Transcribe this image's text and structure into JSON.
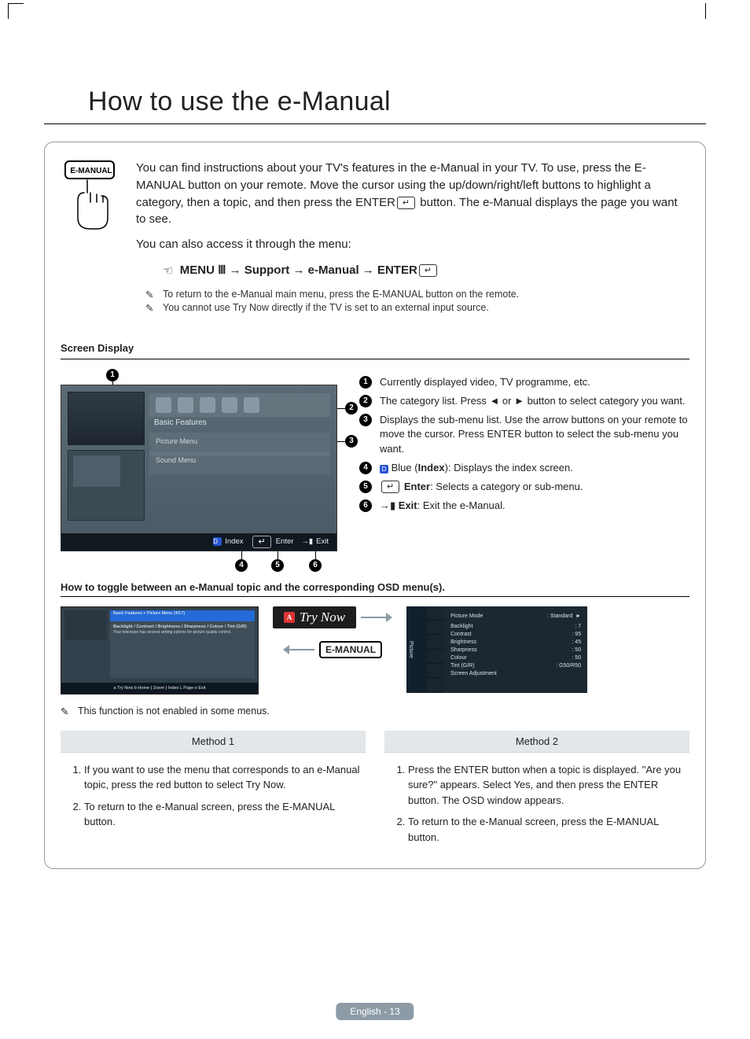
{
  "page_title": "How to use the e-Manual",
  "intro": {
    "button_label": "E-MANUAL",
    "para": "You can find instructions about your TV's features in the e-Manual in your TV. To use, press the E-MANUAL button on your remote. Move the cursor using the up/down/right/left buttons to highlight a category, then a topic, and then press the ENTER",
    "para_suffix": " button. The e-Manual displays the page you want to see.",
    "also": "You can also access it through the menu:",
    "menu_path": "MENU Ⅲ → Support → e-Manual → ENTER",
    "notes": [
      "To return to the e-Manual main menu, press the E-MANUAL button on the remote.",
      "You cannot use Try Now directly if the TV is set to an external input source."
    ]
  },
  "screen_display": {
    "heading": "Screen Display",
    "category_label": "Basic Features",
    "sub1": "Picture Menu",
    "sub2": "Sound Menu",
    "footer": {
      "index": "Index",
      "enter": "Enter",
      "exit": "Exit"
    },
    "legend": {
      "1": "Currently displayed video, TV programme, etc.",
      "2": "The category list. Press ◄ or ► button to select category you want.",
      "3": "Displays the sub-menu list. Use the arrow buttons on your remote to move the cursor. Press ENTER button to select the sub-menu you want.",
      "4_pre": "Blue (",
      "4_b": "Index",
      "4_post": "): Displays the index screen.",
      "5_b": "Enter",
      "5_post": ": Selects a category or sub-menu.",
      "6_b": "Exit",
      "6_post": ": Exit the e-Manual."
    }
  },
  "toggle": {
    "heading": "How to toggle between an e-Manual topic and the corresponding OSD menu(s).",
    "manual_screenshot": {
      "breadcrumb": "Basic Features > Picture Menu (4/17)",
      "title": "Backlight / Contrast / Brightness / Sharpness / Colour / Tint (G/R)",
      "desc": "Your television has several setting options for picture quality control.",
      "footer": "a Try Now   b Home   { Zoom   } Index   L Page   e Exit"
    },
    "try_now": "Try Now",
    "emanual": "E-MANUAL",
    "osd": {
      "side": "Picture",
      "picture_mode": {
        "label": "Picture Mode",
        "value": ": Standard",
        "arrow": "►"
      },
      "rows": [
        {
          "label": "Backlight",
          "value": ": 7"
        },
        {
          "label": "Contrast",
          "value": ": 95"
        },
        {
          "label": "Brightness",
          "value": ": 45"
        },
        {
          "label": "Sharpness",
          "value": ": 50"
        },
        {
          "label": "Colour",
          "value": ": 50"
        },
        {
          "label": "Tint (G/R)",
          "value": ": G50/R50"
        },
        {
          "label": "Screen Adjustment",
          "value": ""
        }
      ]
    },
    "note": "This function is not enabled in some menus."
  },
  "methods": {
    "h1": "Method 1",
    "h2": "Method 2",
    "m1": [
      "If you want to use the menu that corresponds to an e-Manual topic, press the red button to select Try Now.",
      "To return to the e-Manual screen, press the E-MANUAL button."
    ],
    "m2": [
      "Press the ENTER button when a topic is displayed. \"Are you sure?\" appears. Select Yes, and then press the ENTER button. The OSD window appears.",
      "To return to the e-Manual screen, press the E-MANUAL button."
    ]
  },
  "footer": "English - 13"
}
